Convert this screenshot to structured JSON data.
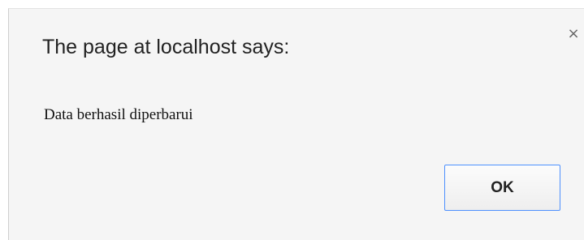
{
  "dialog": {
    "title": "The page at localhost says:",
    "close_icon": "×",
    "message": "Data berhasil diperbarui",
    "ok_label": "OK"
  },
  "icons": {
    "close": "close-icon"
  },
  "colors": {
    "dialog_background": "#f5f5f5",
    "ok_button_border": "#4d90fe"
  }
}
